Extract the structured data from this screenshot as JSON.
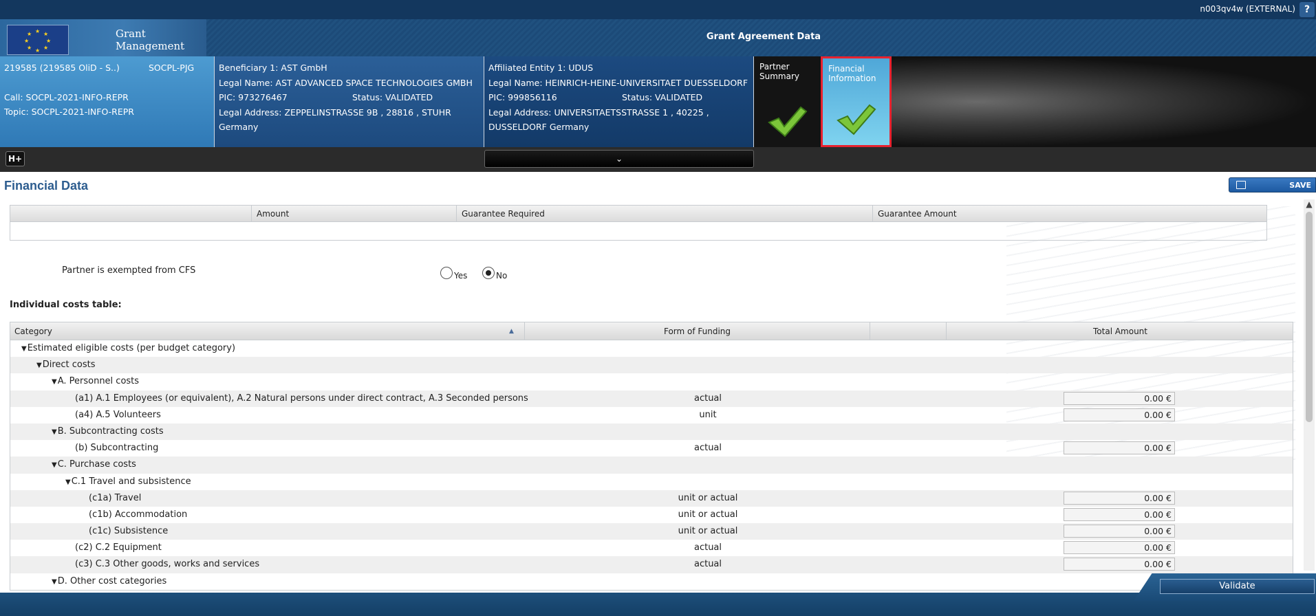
{
  "topbar": {
    "user": "n003qv4w (EXTERNAL)",
    "help": "?"
  },
  "brand": {
    "line1": "Grant",
    "line2": "Management"
  },
  "heading": "Grant Agreement Data",
  "project": {
    "id": "219585 (219585 OliD - S..)",
    "code": "SOCPL-PJG",
    "call": "Call: SOCPL-2021-INFO-REPR",
    "topic": "Topic: SOCPL-2021-INFO-REPR"
  },
  "beneficiary": {
    "title": "Beneficiary 1: AST GmbH",
    "legal_name": "Legal Name: AST ADVANCED SPACE TECHNOLOGIES GMBH",
    "pic": "PIC: 973276467",
    "status": "Status: VALIDATED",
    "address1": "Legal Address: ZEPPELINSTRASSE 9B , 28816 , STUHR",
    "address2": "Germany"
  },
  "affiliated": {
    "title": "Affiliated Entity 1: UDUS",
    "legal_name": "Legal Name: HEINRICH-HEINE-UNIVERSITAET DUESSELDORF",
    "pic": "PIC: 999856116",
    "status": "Status: VALIDATED",
    "address1": "Legal Address: UNIVERSITAETSSTRASSE 1 , 40225 ,",
    "address2": "DUSSELDORF Germany"
  },
  "tiles": {
    "summary_line1": "Partner",
    "summary_line2": "Summary",
    "financial_line1": "Financial",
    "financial_line2": "Information"
  },
  "toolbar": {
    "hplus": "H+",
    "collapse_icon": "⌄"
  },
  "content": {
    "title": "Financial Data",
    "save_label": "SAVE",
    "guarantee_headers": {
      "amount": "Amount",
      "required": "Guarantee Required",
      "guarantee_amount": "Guarantee Amount"
    },
    "exempt_label": "Partner is exempted from CFS",
    "radio_yes": "Yes",
    "radio_no": "No",
    "radio_selected": "No",
    "table_label": "Individual costs table:",
    "table_headers": {
      "category": "Category",
      "form": "Form of Funding",
      "total": "Total Amount"
    },
    "rows": [
      {
        "level": 1,
        "toggle": "▼",
        "label": "Estimated eligible costs (per budget category)",
        "form": "",
        "amount": ""
      },
      {
        "level": 2,
        "toggle": "▼",
        "label": "Direct costs",
        "form": "",
        "amount": ""
      },
      {
        "level": 3,
        "toggle": "▼",
        "label": "A. Personnel costs",
        "form": "",
        "amount": ""
      },
      {
        "level": 4,
        "toggle": "",
        "label": "(a1) A.1 Employees (or equivalent), A.2 Natural persons under direct contract, A.3 Seconded persons",
        "form": "actual",
        "amount": "0.00 €"
      },
      {
        "level": 4,
        "toggle": "",
        "label": "(a4) A.5 Volunteers",
        "form": "unit",
        "amount": "0.00 €"
      },
      {
        "level": 3,
        "toggle": "▼",
        "label": "B. Subcontracting costs",
        "form": "",
        "amount": ""
      },
      {
        "level": 4,
        "toggle": "",
        "label": "(b) Subcontracting",
        "form": "actual",
        "amount": "0.00 €"
      },
      {
        "level": 3,
        "toggle": "▼",
        "label": "C. Purchase costs",
        "form": "",
        "amount": ""
      },
      {
        "level": 4,
        "toggle": "▼",
        "label": "C.1 Travel and subsistence",
        "form": "",
        "amount": ""
      },
      {
        "level": 5,
        "toggle": "",
        "label": "(c1a) Travel",
        "form": "unit or actual",
        "amount": "0.00 €"
      },
      {
        "level": 5,
        "toggle": "",
        "label": "(c1b) Accommodation",
        "form": "unit or actual",
        "amount": "0.00 €"
      },
      {
        "level": 5,
        "toggle": "",
        "label": "(c1c) Subsistence",
        "form": "unit or actual",
        "amount": "0.00 €"
      },
      {
        "level": 4,
        "toggle": "",
        "label": "(c2) C.2 Equipment",
        "form": "actual",
        "amount": "0.00 €"
      },
      {
        "level": 4,
        "toggle": "",
        "label": "(c3) C.3 Other goods, works and services",
        "form": "actual",
        "amount": "0.00 €"
      },
      {
        "level": 3,
        "toggle": "▼",
        "label": "D. Other cost categories",
        "form": "",
        "amount": ""
      }
    ]
  },
  "validate_label": "Validate",
  "colors": {
    "accent": "#2d5d8f",
    "highlight_border": "#e8222f",
    "check_green": "#7cc63a"
  }
}
